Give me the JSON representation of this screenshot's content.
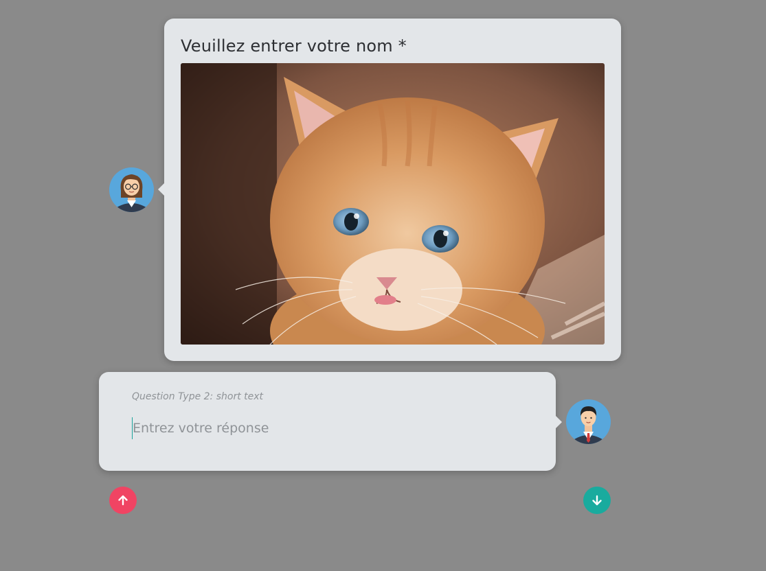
{
  "question": {
    "title": "Veuillez entrer votre nom *",
    "image_subject": "orange kitten looking up"
  },
  "answer": {
    "type_label": "Question Type 2: short text",
    "placeholder": "Entrez votre réponse",
    "value": ""
  },
  "avatars": {
    "bot": "female-agent-avatar",
    "user": "male-user-avatar"
  },
  "navigation": {
    "up_icon": "arrow-up-icon",
    "down_icon": "arrow-down-icon"
  },
  "colors": {
    "background": "#8a8a8a",
    "bubble": "#e3e6e9",
    "up_button": "#f04463",
    "down_button": "#19ab9e",
    "avatar_bg": "#58a7dc"
  }
}
